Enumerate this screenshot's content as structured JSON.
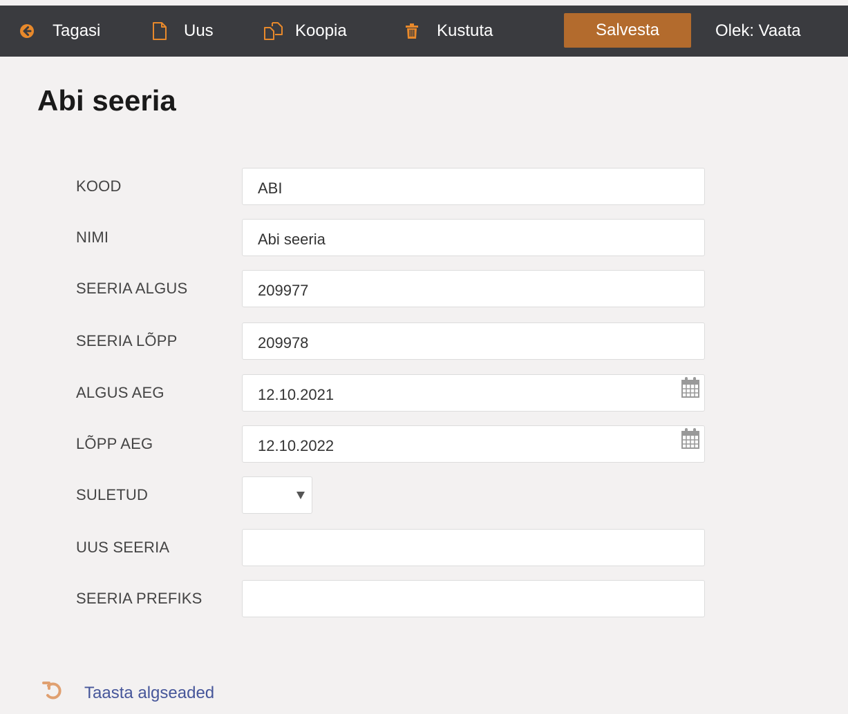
{
  "toolbar": {
    "back_label": "Tagasi",
    "new_label": "Uus",
    "copy_label": "Koopia",
    "delete_label": "Kustuta",
    "save_label": "Salvesta",
    "status_label": "Olek: Vaata",
    "accent_color": "#b36b2d",
    "bar_color": "#3a3b3f",
    "back_icon_color": "#e8892b"
  },
  "page": {
    "title": "Abi seeria"
  },
  "form": {
    "kood": {
      "label": "KOOD",
      "value": "ABI"
    },
    "nimi": {
      "label": "NIMI",
      "value": "Abi seeria"
    },
    "seeria_algus": {
      "label": "SEERIA ALGUS",
      "value": "209977"
    },
    "seeria_lopp": {
      "label": "SEERIA LÕPP",
      "value": "209978"
    },
    "algus_aeg": {
      "label": "ALGUS AEG",
      "value": "12.10.2021"
    },
    "lopp_aeg": {
      "label": "LÕPP AEG",
      "value": "12.10.2022"
    },
    "suletud": {
      "label": "SULETUD",
      "value": ""
    },
    "uus_seeria": {
      "label": "UUS SEERIA",
      "value": ""
    },
    "seeria_prefiks": {
      "label": "SEERIA PREFIKS",
      "value": ""
    }
  },
  "footer": {
    "restore_label": "Taasta algseaded"
  },
  "icons": {
    "back": "arrow-left-circle-icon",
    "new": "document-icon",
    "copy": "copy-icon",
    "delete": "trash-icon",
    "calendar": "calendar-icon",
    "restore": "undo-icon",
    "dropdown": "chevron-down-icon"
  }
}
